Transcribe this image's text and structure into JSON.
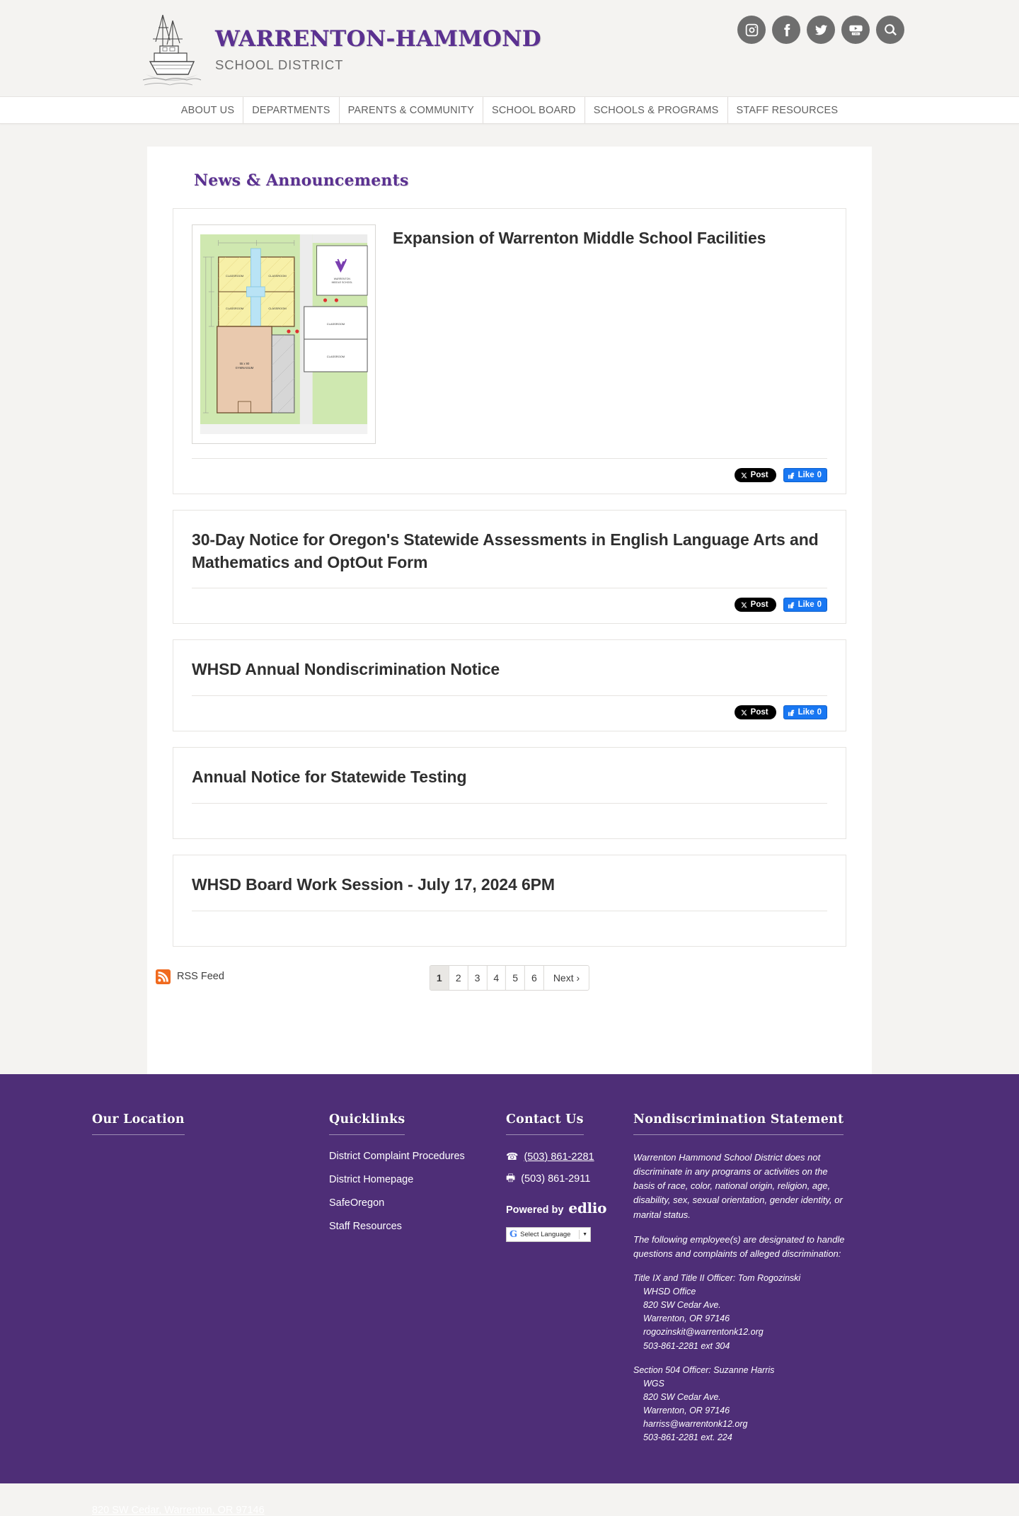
{
  "header": {
    "district_name": "WARRENTON-HAMMOND",
    "district_sub": "SCHOOL DISTRICT",
    "logo_alt": "fishing-boat-logo",
    "social": [
      {
        "name": "instagram-icon",
        "label": "Instagram"
      },
      {
        "name": "facebook-icon",
        "label": "Facebook"
      },
      {
        "name": "twitter-icon",
        "label": "Twitter"
      },
      {
        "name": "youtube-icon",
        "label": "YouTube"
      },
      {
        "name": "search-icon",
        "label": "Search"
      }
    ]
  },
  "nav": {
    "items": [
      {
        "label": "ABOUT US"
      },
      {
        "label": "DEPARTMENTS"
      },
      {
        "label": "PARENTS & COMMUNITY"
      },
      {
        "label": "SCHOOL BOARD"
      },
      {
        "label": "SCHOOLS & PROGRAMS"
      },
      {
        "label": "STAFF RESOURCES"
      }
    ]
  },
  "main": {
    "section_title": "News & Announcements",
    "articles": [
      {
        "title": "Expansion of Warrenton Middle School Facilities",
        "has_image": true,
        "image_alt": "warrenton-middle-school-site-floor-plan",
        "share": {
          "x_label": "Post",
          "fb_label": "Like",
          "fb_count": "0"
        }
      },
      {
        "title": "30-Day Notice for Oregon's Statewide Assessments in English Language Arts and Mathematics and OptOut Form",
        "has_image": false,
        "share": {
          "x_label": "Post",
          "fb_label": "Like",
          "fb_count": "0"
        }
      },
      {
        "title": "WHSD Annual Nondiscrimination Notice",
        "has_image": false,
        "share": {
          "x_label": "Post",
          "fb_label": "Like",
          "fb_count": "0"
        }
      },
      {
        "title": "Annual Notice for Statewide Testing",
        "has_image": false,
        "share": null
      },
      {
        "title": "WHSD Board Work Session - July 17, 2024 6PM",
        "has_image": false,
        "share": null
      }
    ],
    "rss_label": "RSS Feed",
    "pagination": {
      "pages": [
        "1",
        "2",
        "3",
        "4",
        "5",
        "6"
      ],
      "active": "1",
      "next_label": "Next ›"
    }
  },
  "footer": {
    "location": {
      "heading": "Our Location",
      "address": "820 SW Cedar, Warrenton, OR 97146"
    },
    "quicklinks": {
      "heading": "Quicklinks",
      "items": [
        {
          "label": "District Complaint Procedures"
        },
        {
          "label": "District Homepage"
        },
        {
          "label": "SafeOregon"
        },
        {
          "label": "Staff Resources"
        }
      ]
    },
    "contact": {
      "heading": "Contact Us",
      "phone": "(503) 861-2281",
      "fax": "(503) 861-2911",
      "powered_by": "Powered by",
      "powered_brand": "edlio",
      "translate_label": "Select Language"
    },
    "nondiscrimination": {
      "heading": "Nondiscrimination Statement",
      "para1": "Warrenton Hammond School District does not discriminate in any programs or activities on the basis of race, color, national origin, religion, age, disability, sex, sexual orientation, gender identity, or marital status.",
      "para2": "The following employee(s) are designated to handle questions and complaints of alleged discrimination:",
      "officers": [
        {
          "title": "Title IX and Title II Officer: Tom Rogozinski",
          "org": "WHSD Office",
          "street": "820 SW Cedar Ave.",
          "city": "Warrenton, OR 97146",
          "email": "rogozinskit@warrentonk12.org",
          "phone": "503-861-2281 ext 304"
        },
        {
          "title": "Section 504 Officer: Suzanne Harris",
          "org": "WGS",
          "street": "820 SW Cedar Ave.",
          "city": "Warrenton, OR 97146",
          "email": "harriss@warrentonk12.org",
          "phone": "503-861-2281 ext. 224"
        }
      ]
    }
  },
  "colors": {
    "brand_purple": "#5b3191",
    "footer_purple": "#4e2e77",
    "page_bg": "#f4f3f1",
    "rss_orange": "#f06a1e",
    "facebook_blue": "#1877f2"
  }
}
